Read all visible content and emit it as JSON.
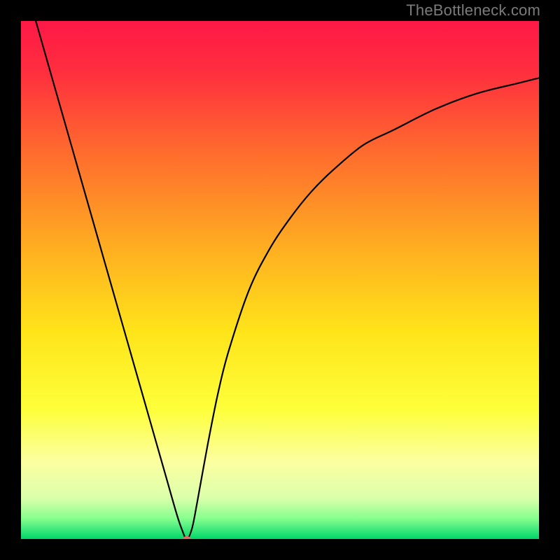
{
  "watermark": "TheBottleneck.com",
  "chart_data": {
    "type": "line",
    "title": "",
    "xlabel": "",
    "ylabel": "",
    "xlim": [
      0,
      100
    ],
    "ylim": [
      0,
      100
    ],
    "grid": false,
    "legendpos": "none",
    "background_gradient_stops": [
      {
        "pct": 0,
        "color": "#ff1846"
      },
      {
        "pct": 10,
        "color": "#ff2f3e"
      },
      {
        "pct": 25,
        "color": "#ff6a2e"
      },
      {
        "pct": 45,
        "color": "#ffb220"
      },
      {
        "pct": 60,
        "color": "#ffe41a"
      },
      {
        "pct": 75,
        "color": "#fdff3a"
      },
      {
        "pct": 85,
        "color": "#fcffa0"
      },
      {
        "pct": 92,
        "color": "#dcffab"
      },
      {
        "pct": 96,
        "color": "#88ff8f"
      },
      {
        "pct": 100,
        "color": "#00d66a"
      }
    ],
    "series": [
      {
        "name": "bottleneck-curve",
        "color": "#000000",
        "x": [
          0,
          2,
          4,
          6,
          8,
          10,
          12,
          14,
          16,
          18,
          20,
          22,
          24,
          26,
          28,
          30,
          31,
          32,
          33,
          34,
          36,
          38,
          40,
          44,
          48,
          52,
          56,
          60,
          66,
          72,
          80,
          88,
          96,
          100
        ],
        "y": [
          110,
          103,
          96,
          89,
          82,
          75,
          68,
          61,
          54,
          47,
          40,
          33,
          26,
          19,
          12,
          5,
          2,
          0,
          2,
          7,
          18,
          28,
          36,
          48,
          56,
          62,
          67,
          71,
          76,
          79,
          83,
          86,
          88,
          89
        ]
      }
    ],
    "marker": {
      "name": "optimal-point",
      "x": 32,
      "y": 0,
      "color": "#e46a5f",
      "rx": 6,
      "ry": 4
    }
  }
}
